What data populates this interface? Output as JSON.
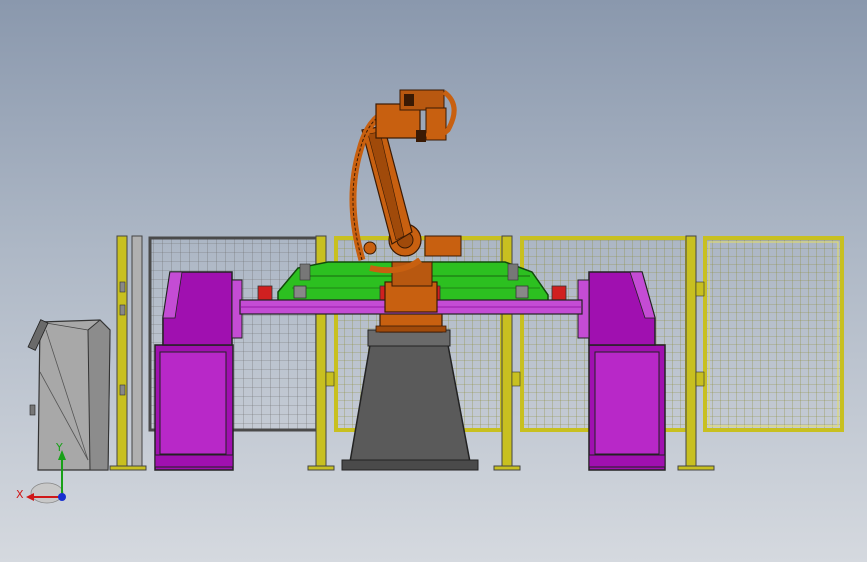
{
  "viewport": {
    "title": "",
    "view": "front"
  },
  "triad": {
    "x_label": "X",
    "y_label": "Y",
    "x_color": "#d01818",
    "y_color": "#18a018",
    "z_color": "#1830d0"
  },
  "colors": {
    "fence_frame": "#c8c020",
    "fence_mesh": "#6a6a6a",
    "positioner": "#a010b0",
    "positioner_light": "#c44cd4",
    "fixture": "#2cc020",
    "robot": "#c86010",
    "robot_dark": "#8a3c08",
    "pedestal": "#5a5a5a",
    "cabinet": "#a8a8a8"
  }
}
